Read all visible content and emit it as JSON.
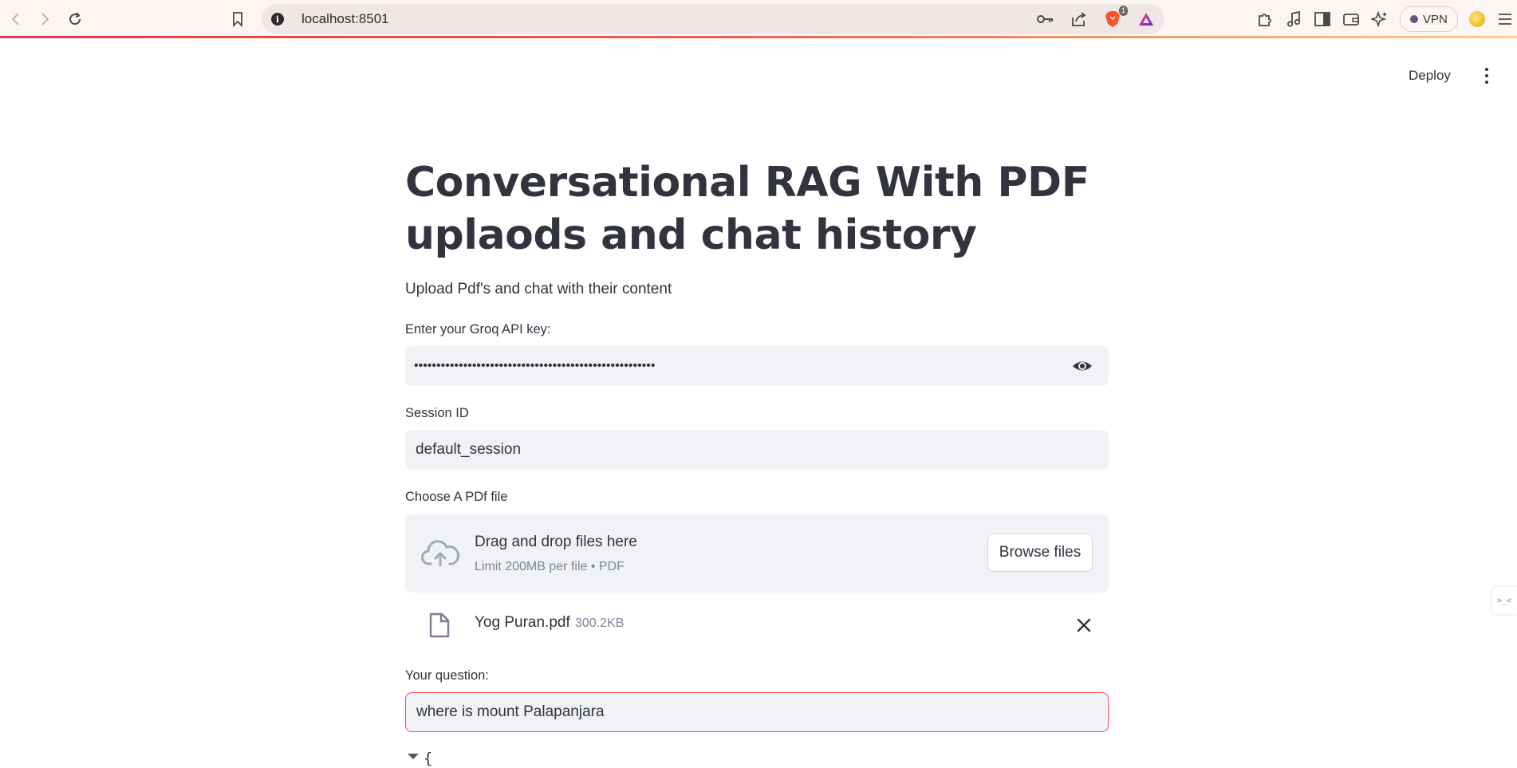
{
  "browser": {
    "url": "localhost:8501",
    "vpn_label": "VPN",
    "brave_badge": "1"
  },
  "app_header": {
    "deploy_label": "Deploy"
  },
  "page": {
    "title": "Conversational RAG With PDF uplaods and chat history",
    "subtitle": "Upload Pdf's and chat with their content"
  },
  "api_key": {
    "label": "Enter your Groq API key:",
    "masked_value": "••••••••••••••••••••••••••••••••••••••••••••••••••••••"
  },
  "session": {
    "label": "Session ID",
    "value": "default_session"
  },
  "uploader": {
    "label": "Choose A PDf file",
    "drop_title": "Drag and drop files here",
    "drop_subtitle": "Limit 200MB per file • PDF",
    "browse_label": "Browse files",
    "file_name": "Yog Puran.pdf",
    "file_size": "300.2KB"
  },
  "question": {
    "label": "Your question:",
    "value": "where is mount Palapanjara"
  },
  "json_output": {
    "open_brace": "{"
  },
  "side_tab": {
    "label": ">_<"
  },
  "colors": {
    "accent": "#ff4b4b",
    "input_bg": "#f0f2f6",
    "text": "#31333f",
    "muted": "#808495"
  }
}
